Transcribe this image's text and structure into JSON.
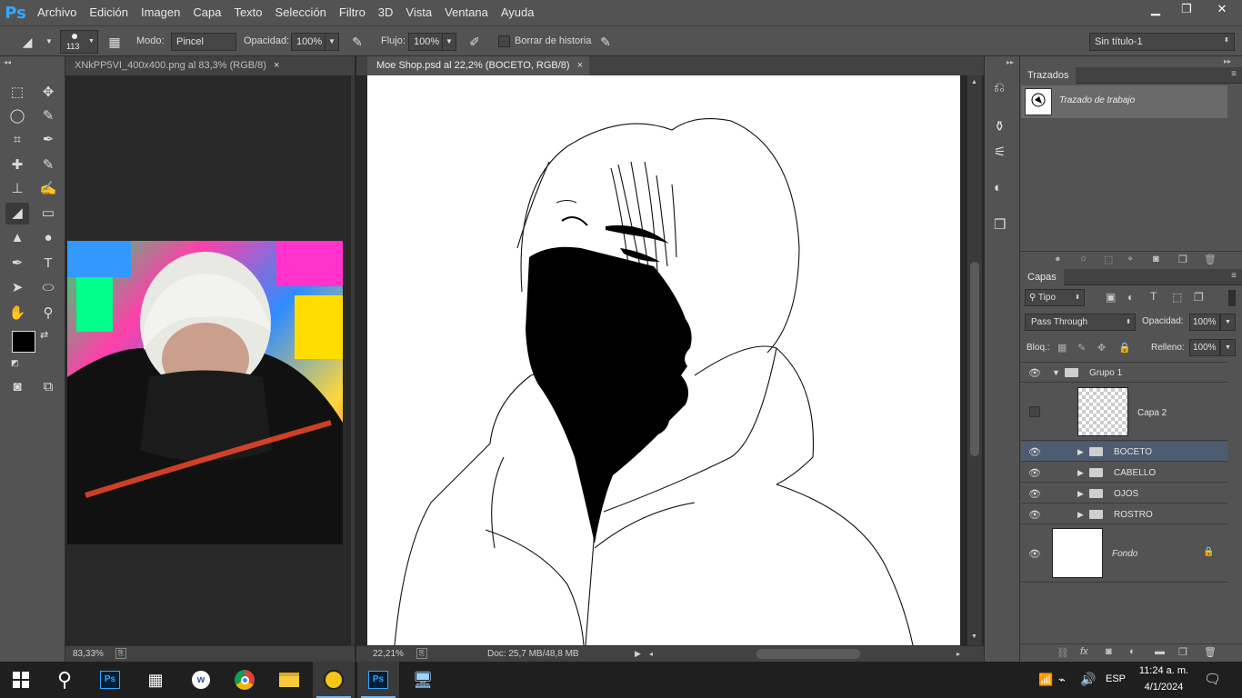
{
  "app": {
    "logo": "Ps"
  },
  "menu": [
    "Archivo",
    "Edición",
    "Imagen",
    "Capa",
    "Texto",
    "Selección",
    "Filtro",
    "3D",
    "Vista",
    "Ventana",
    "Ayuda"
  ],
  "window_controls": {
    "minimize": "▁",
    "restore": "❐",
    "close": "✕"
  },
  "options": {
    "brush_size": "113",
    "mode_label": "Modo:",
    "mode_value": "Pincel",
    "opacity_label": "Opacidad:",
    "opacity_value": "100%",
    "flow_label": "Flujo:",
    "flow_value": "100%",
    "history_label": "Borrar de historia",
    "workspace_value": "Sin título-1"
  },
  "documents": [
    {
      "title": "XNkPP5VI_400x400.png al 83,3% (RGB/8)",
      "close": "×",
      "zoom": "83,33%"
    },
    {
      "title": "Moe Shop.psd al 22,2% (BOCETO, RGB/8)",
      "close": "×",
      "zoom": "22,21%",
      "doc_info": "Doc: 25,7 MB/48,8 MB"
    }
  ],
  "paths_panel": {
    "tab": "Trazados",
    "items": [
      {
        "name": "Trazado de trabajo"
      }
    ]
  },
  "layers_panel": {
    "tab": "Capas",
    "filter_label": "Tipo",
    "blend_mode": "Pass Through",
    "opacity_label": "Opacidad:",
    "opacity_value": "100%",
    "lock_label": "Bloq.:",
    "fill_label": "Relleno:",
    "fill_value": "100%",
    "group": {
      "name": "Grupo 1"
    },
    "layer2": {
      "name": "Capa 2"
    },
    "subgroups": [
      {
        "name": "BOCETO",
        "selected": true
      },
      {
        "name": "CABELLO",
        "selected": false
      },
      {
        "name": "OJOS",
        "selected": false
      },
      {
        "name": "ROSTRO",
        "selected": false
      }
    ],
    "background": {
      "name": "Fondo"
    }
  },
  "taskbar": {
    "language": "ESP",
    "time": "11:24 a. m.",
    "date": "4/1/2024"
  },
  "colors": {
    "accent": "#31a8ff",
    "selected_layer": "#4d5c70",
    "canvas": "#ffffff"
  }
}
